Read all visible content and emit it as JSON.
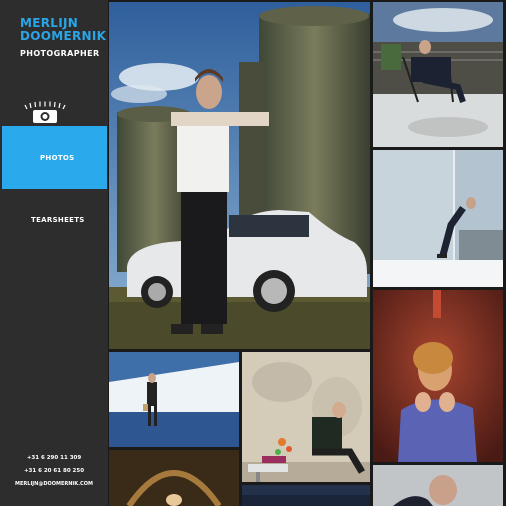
{
  "brand": {
    "line1": "MERLIJN",
    "line2": "DOOMERNIK",
    "tagline": "PHOTOGRAPHER"
  },
  "nav": {
    "photos": "PHOTOS",
    "tearsheets": "TEARSHEETS"
  },
  "contact": {
    "phone1": "+31 6 290 11 309",
    "phone2": "+31 6 20 61 80 250",
    "email": "MERLIJN@DOOMERNIK.COM"
  },
  "colors": {
    "accent": "#2aa9ec",
    "sidebar": "#2d2d2d"
  }
}
